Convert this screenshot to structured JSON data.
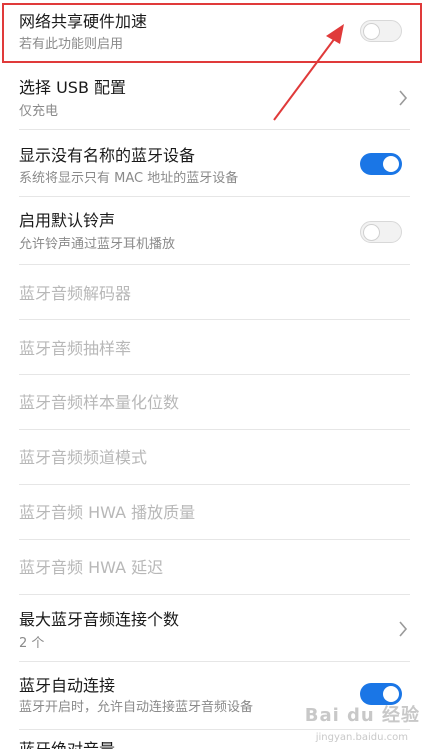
{
  "settings": [
    {
      "title": "网络共享硬件加速",
      "subtitle": "若有此功能则启用",
      "control": "toggle",
      "state": "off"
    },
    {
      "title": "选择 USB 配置",
      "subtitle": "仅充电",
      "control": "chevron"
    },
    {
      "title": "显示没有名称的蓝牙设备",
      "subtitle": "系统将显示只有 MAC 地址的蓝牙设备",
      "control": "toggle",
      "state": "on"
    },
    {
      "title": "启用默认铃声",
      "subtitle": "允许铃声通过蓝牙耳机播放",
      "control": "toggle",
      "state": "off"
    },
    {
      "title": "蓝牙音频解码器",
      "disabled": true
    },
    {
      "title": "蓝牙音频抽样率",
      "disabled": true
    },
    {
      "title": "蓝牙音频样本量化位数",
      "disabled": true
    },
    {
      "title": "蓝牙音频频道模式",
      "disabled": true
    },
    {
      "title": "蓝牙音频 HWA 播放质量",
      "disabled": true
    },
    {
      "title": "蓝牙音频 HWA 延迟",
      "disabled": true
    },
    {
      "title": "最大蓝牙音频连接个数",
      "subtitle": "2 个",
      "control": "chevron"
    },
    {
      "title": "蓝牙自动连接",
      "subtitle": "蓝牙开启时，允许自动连接蓝牙音频设备",
      "control": "toggle",
      "state": "on"
    },
    {
      "title": "蓝牙绝对音量"
    }
  ],
  "colors": {
    "toggle_on": "#1a76e6",
    "highlight": "#e03a3a",
    "disabled_text": "#b8b8b8"
  },
  "watermark": {
    "text": "Bai du 经验",
    "subtext": "jingyan.baidu.com"
  }
}
